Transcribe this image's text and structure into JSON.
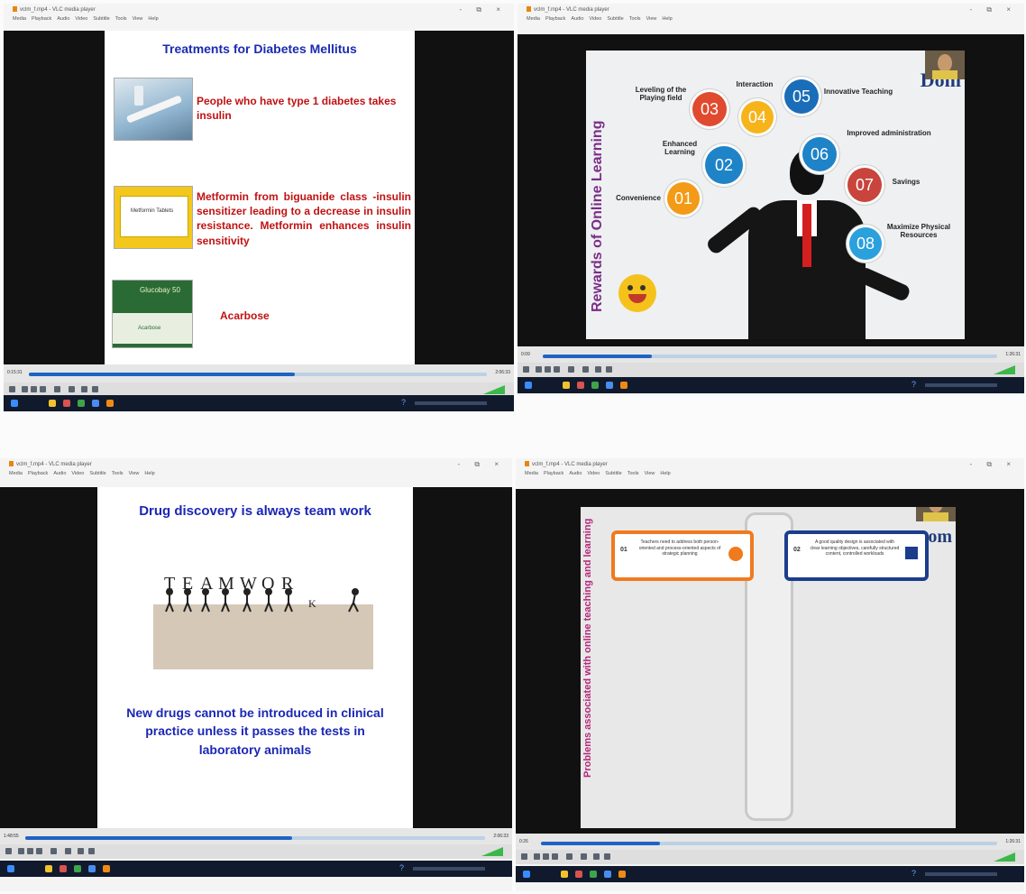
{
  "window_title": "vclm_f.mp4 - VLC media player",
  "window_controls": "- ⧉ ×",
  "menu": [
    "Media",
    "Playback",
    "Audio",
    "Video",
    "Subtitle",
    "Tools",
    "View",
    "Help"
  ],
  "colors": {
    "video_bg": "#111111",
    "progress": "#1f63c4",
    "taskbar": "#101a2c",
    "slide1_title": "#1a2bb0",
    "slide1_text": "#c01212",
    "slide3_text": "#1b27b5",
    "slide2_title": "#7b2d87",
    "slide4_title": "#b5287a"
  },
  "panels": [
    {
      "id": "top-left",
      "time_elapsed": "0:15:31",
      "time_total": "2:06:33",
      "progress": 0.58,
      "slide": {
        "title": "Treatments for Diabetes Mellitus",
        "items": [
          {
            "text": "People who have type 1 diabetes takes insulin",
            "icon": "insulin-pen-image"
          },
          {
            "text": "Metformin from biguanide class -insulin sensitizer leading to a decrease in insulin resistance. Metformin enhances insulin sensitivity",
            "icon": "metformin-box-image"
          },
          {
            "text": "Acarbose",
            "icon": "glucobay-box-image"
          }
        ],
        "box_labels": [
          "Metformin Tablets",
          "Glucobay 50",
          "Acarbose"
        ]
      }
    },
    {
      "id": "top-right",
      "time_elapsed": "0:09",
      "time_total": "1:26:31",
      "progress": 0.24,
      "slide": {
        "title": "Rewards of Online Learning",
        "logo": "Dom",
        "bubbles": [
          {
            "num": "01",
            "label": "Convenience",
            "color": "#f39a16"
          },
          {
            "num": "02",
            "label": "Enhanced Learning",
            "color": "#1f83c8"
          },
          {
            "num": "03",
            "label": "Leveling of the Playing field",
            "color": "#e04a2e"
          },
          {
            "num": "04",
            "label": "Interaction",
            "color": "#f6b41a"
          },
          {
            "num": "05",
            "label": "Innovative Teaching",
            "color": "#1a6db8"
          },
          {
            "num": "06",
            "label": "Improved administration",
            "color": "#1f83c8"
          },
          {
            "num": "07",
            "label": "Savings",
            "color": "#c8443c"
          },
          {
            "num": "08",
            "label": "Maximize Physical Resources",
            "color": "#2aa0dc"
          }
        ]
      }
    },
    {
      "id": "bottom-left",
      "time_elapsed": "1:48:55",
      "time_total": "2:06:33",
      "progress": 0.58,
      "slide": {
        "title": "Drug discovery is always team work",
        "letters": [
          "T",
          "E",
          "A",
          "M",
          "W",
          "O",
          "R",
          "K"
        ],
        "bottom_text": "New drugs cannot be introduced in clinical practice unless it passes the tests in laboratory animals"
      }
    },
    {
      "id": "bottom-right",
      "time_elapsed": "0:26",
      "time_total": "1:26:31",
      "progress": 0.26,
      "slide": {
        "title": "Problems associated with online teaching and learning",
        "logo": "Dom",
        "cards": [
          {
            "num": "01",
            "text": "Teachers need to address both person-oriented and process-oriented aspects of strategic planning",
            "color": "#f07a1e"
          },
          {
            "num": "02",
            "text": "A good quality design is associated with clear learning objectives, carefully structured content, controlled workloads",
            "color": "#1b3d8c"
          }
        ]
      }
    }
  ]
}
